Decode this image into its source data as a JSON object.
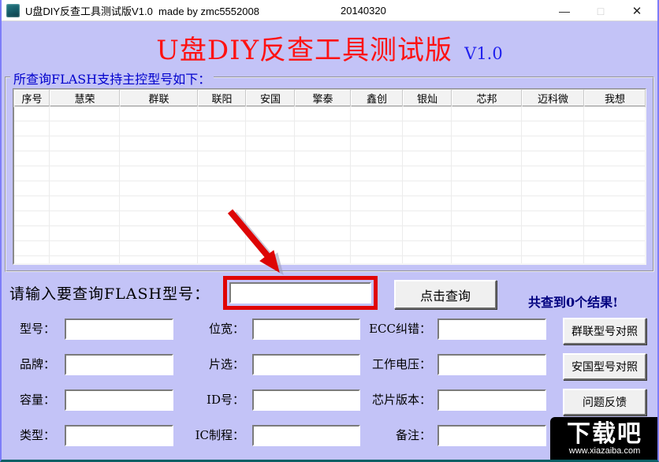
{
  "window": {
    "title": "U盘DIY反查工具测试版V1.0  made by zmc5552008",
    "date": "20140320",
    "controls": {
      "minimize": "—",
      "maximize": "□",
      "close": "✕"
    }
  },
  "header": {
    "title": "U盘DIY反查工具测试版",
    "version": "V1.0"
  },
  "groupbox": {
    "label": "所查询FLASH支持主控型号如下："
  },
  "table": {
    "columns": [
      "序号",
      "慧荣",
      "群联",
      "联阳",
      "安国",
      "擎泰",
      "鑫创",
      "银灿",
      "芯邦",
      "迈科微",
      "我想"
    ],
    "rows": []
  },
  "query": {
    "label": "请输入要查询FLASH型号：",
    "input_value": "",
    "search_button": "点击查询",
    "result_text": "共查到0个结果!"
  },
  "form": {
    "rows": [
      {
        "c1": "型号：",
        "c1_value": "",
        "c2": "位宽：",
        "c2_value": "",
        "c3": "ECC纠错：",
        "c3_value": ""
      },
      {
        "c1": "品牌：",
        "c1_value": "",
        "c2": "片选：",
        "c2_value": "",
        "c3": "工作电压：",
        "c3_value": ""
      },
      {
        "c1": "容量：",
        "c1_value": "",
        "c2": "ID号：",
        "c2_value": "",
        "c3": "芯片版本：",
        "c3_value": ""
      },
      {
        "c1": "类型：",
        "c1_value": "",
        "c2": "IC制程：",
        "c2_value": "",
        "c3": "备注：",
        "c3_value": ""
      }
    ]
  },
  "side_buttons": {
    "phison": "群联型号对照",
    "alcor": "安国型号对照",
    "feedback": "问题反馈"
  },
  "watermark": {
    "logo": "下载吧",
    "url": "www.xiazaiba.com"
  },
  "colors": {
    "background": "#c3c3f7",
    "title_red": "#ff1212",
    "version_blue": "#2222ee",
    "group_label_blue": "#0000cc",
    "result_navy": "#00007f",
    "highlight_red": "#e00404",
    "watermark_bg": "#000000"
  }
}
